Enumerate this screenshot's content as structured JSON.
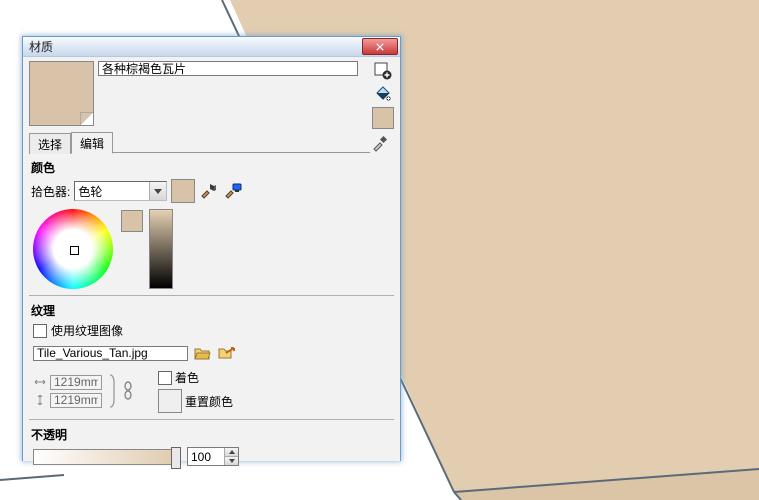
{
  "window": {
    "title": "材质",
    "close_aria": "Close"
  },
  "material": {
    "name": "各种棕褐色瓦片"
  },
  "tabs": {
    "select": "选择",
    "edit": "编辑"
  },
  "color": {
    "section": "颜色",
    "picker_label": "拾色器:",
    "picker_value": "色轮"
  },
  "texture": {
    "section": "纹理",
    "use_image": "使用纹理图像",
    "file": "Tile_Various_Tan.jpg",
    "width": "1219mm",
    "height": "1219mm",
    "colorize": "着色",
    "reset_color": "重置颜色"
  },
  "opacity": {
    "section": "不透明",
    "value": "100"
  }
}
